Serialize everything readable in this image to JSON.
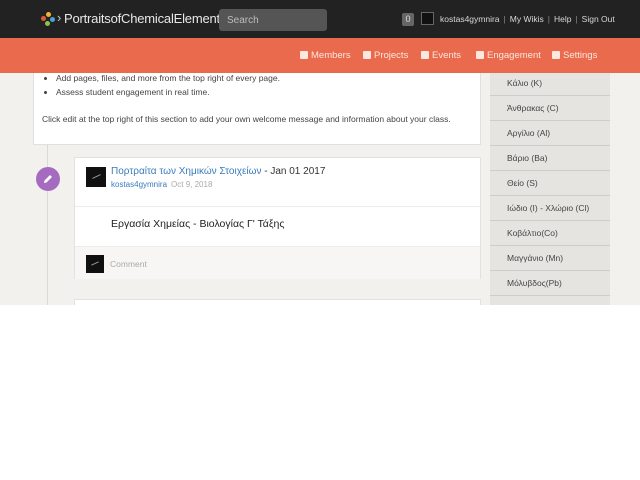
{
  "topbar": {
    "brand": "PortraitsofChemicalElements",
    "search_placeholder": "Search",
    "notifications": "0",
    "user": "kostas4gymnira",
    "links": [
      "My Wikis",
      "Help",
      "Sign Out"
    ]
  },
  "nav": {
    "items": [
      {
        "label": "Members",
        "icon": "members-icon"
      },
      {
        "label": "Projects",
        "icon": "projects-icon"
      },
      {
        "label": "Events",
        "icon": "calendar-icon"
      },
      {
        "label": "Engagement",
        "icon": "chart-icon"
      },
      {
        "label": "Settings",
        "icon": "gear-icon"
      }
    ]
  },
  "welcome": {
    "bullets": [
      "Add pages, files, and more from the top right of every page.",
      "Assess student engagement in real time."
    ],
    "note": "Click edit at the top right of this section to add your own welcome message and information about your class."
  },
  "post": {
    "title_link": "Πορτραίτα των Χημικών Στοιχείων",
    "title_suffix": " - Jan 01 2017",
    "author": "kostas4gymnira",
    "date": "Oct 9, 2018",
    "body": "Εργασία Χημείας - Βιολογίας Γ' Τάξης",
    "comment_placeholder": "Comment"
  },
  "sidebar": {
    "items": [
      "Κάλιο (K)",
      "Άνθρακας (C)",
      "Αργίλιο (Al)",
      "Βάριο (Ba)",
      "Θείο (S)",
      "Ιώδιο (I) - Χλώριο (Cl)",
      "Κοβάλτιο(Co)",
      "Μαγγάνιο (Mn)",
      "Μόλυβδος(Pb)"
    ]
  },
  "colors": {
    "topbar": "#222222",
    "nav": "#ea6a4d",
    "edit_circle": "#a46bc0",
    "link": "#3a7bbd"
  }
}
